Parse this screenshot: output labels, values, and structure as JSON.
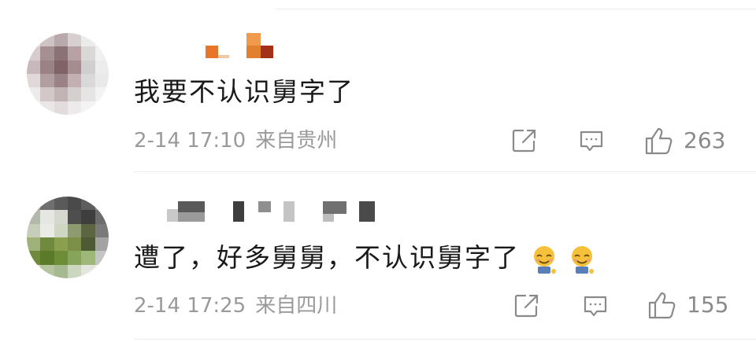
{
  "comments": [
    {
      "text": "我要不认识舅字了",
      "time": "2-14 17:10",
      "location": "来自贵州",
      "likes": "263",
      "emoji": [],
      "avatar_colors": [
        "#e6dfdf",
        "#cfc3c6",
        "#b9a9ad",
        "#d7cfd0",
        "#ecebeb",
        "#f4f4f4",
        "#d8cbcd",
        "#a58f93",
        "#8b7276",
        "#b8a1a5",
        "#dad7d7",
        "#f0f0f0",
        "#c8b8bb",
        "#9b8285",
        "#7f6367",
        "#a48c90",
        "#cfcfcf",
        "#ececec",
        "#e1d8da",
        "#b19ea1",
        "#9a8286",
        "#c2b0b3",
        "#d9d9d9",
        "#e9e9e9",
        "#eceaea",
        "#d2c7c9",
        "#c2b3b5",
        "#d6cfd0",
        "#e5e5e5",
        "#f3f3f3",
        "#f5f5f5",
        "#ebe6e7",
        "#e2dcdd",
        "#eeeaeb",
        "#f4f4f4",
        "#fafafa"
      ]
    },
    {
      "text": "遭了，好多舅舅，不认识舅字了",
      "time": "2-14 17:25",
      "location": "来自四川",
      "likes": "155",
      "emoji": [
        "smile-emoji",
        "smile-emoji"
      ],
      "avatar_colors": [
        "#9a9a9a",
        "#6f6f6f",
        "#5a5a5a",
        "#4a4a4a",
        "#5e5e5e",
        "#8c8c8c",
        "#b3b8ad",
        "#e6e7e3",
        "#d5d8cf",
        "#4e4e4e",
        "#3e3e3e",
        "#6c6c6c",
        "#c6cdb9",
        "#e9ebe4",
        "#cfd6c2",
        "#8e9a6f",
        "#5c6442",
        "#7a7a7a",
        "#9fb079",
        "#6f8a3c",
        "#8aa04e",
        "#7b8f47",
        "#4d5a33",
        "#a3a3a3",
        "#6f8a3a",
        "#5b7a2a",
        "#6e8d37",
        "#88a35a",
        "#9eb87a",
        "#c5c5c5",
        "#d9ddd0",
        "#b6c4a0",
        "#a7b991",
        "#cdd6bf",
        "#e3e6dd",
        "#eeeeee"
      ]
    }
  ],
  "colors": {
    "text": "#1a1a1a",
    "meta": "#9a9a9a",
    "icon": "#8a8a8a",
    "divider": "#ececec"
  }
}
